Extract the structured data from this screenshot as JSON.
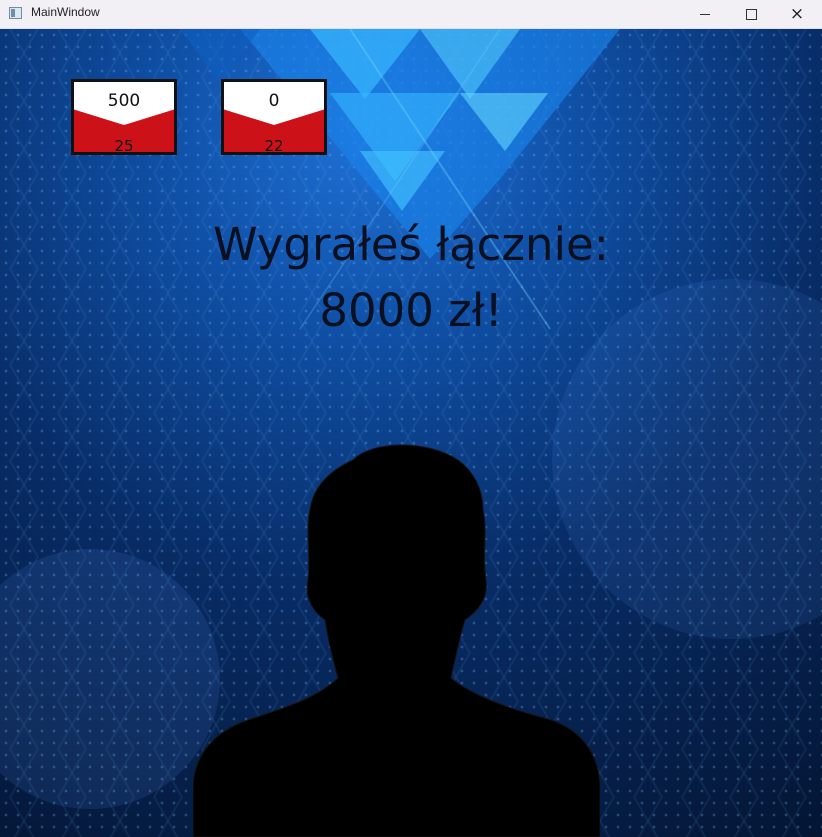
{
  "window": {
    "title": "MainWindow"
  },
  "envelopes": [
    {
      "top_value": "500",
      "bottom_value": "25"
    },
    {
      "top_value": "0",
      "bottom_value": "22"
    }
  ],
  "result": {
    "line1": "Wygrałeś łącznie:",
    "line2": "8000 zł!"
  },
  "colors": {
    "envelope_red": "#cc1218",
    "envelope_white": "#ffffff",
    "background_blue": "#0f4fa5"
  },
  "icons": {
    "app": "window-icon",
    "minimize": "minimize-icon",
    "maximize": "maximize-icon",
    "close": "close-icon"
  }
}
